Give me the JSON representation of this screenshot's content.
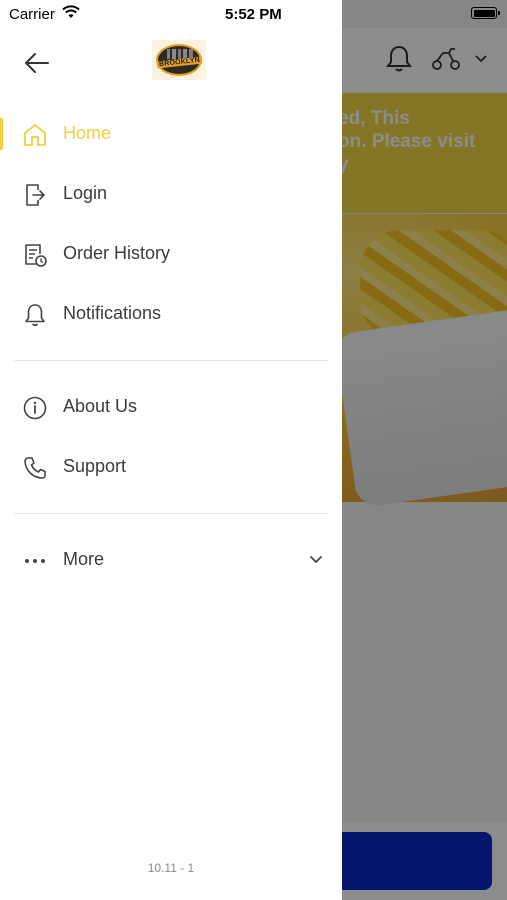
{
  "status_bar": {
    "carrier": "Carrier",
    "time": "5:52 PM"
  },
  "drawer": {
    "back_icon": "arrow-left-icon",
    "logo_text": "BROOKLYN",
    "menu": [
      {
        "label": "Home",
        "icon": "home-icon",
        "active": true
      },
      {
        "label": "Login",
        "icon": "login-icon"
      },
      {
        "label": "Order History",
        "icon": "order-history-icon"
      },
      {
        "label": "Notifications",
        "icon": "bell-icon"
      },
      {
        "label": "About Us",
        "icon": "info-icon"
      },
      {
        "label": "Support",
        "icon": "phone-icon"
      },
      {
        "label": "More",
        "icon": "more-dots-icon"
      }
    ],
    "version": "10.11 - 1"
  },
  "background": {
    "banner_lines": [
      "ed, This",
      "on. Please visit",
      "y"
    ]
  },
  "colors": {
    "accent": "#f2d03b",
    "banner": "#f0d548",
    "cta": "#0a28c9"
  }
}
